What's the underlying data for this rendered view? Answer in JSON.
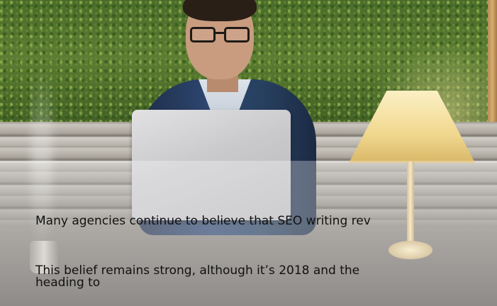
{
  "article": {
    "hero_image": "man-with-laptop-on-bench-photo",
    "paragraphs": [
      "Many agencies continue to believe that SEO writing rev",
      "This belief remains strong, although it’s 2018 and the",
      "heading to"
    ]
  }
}
